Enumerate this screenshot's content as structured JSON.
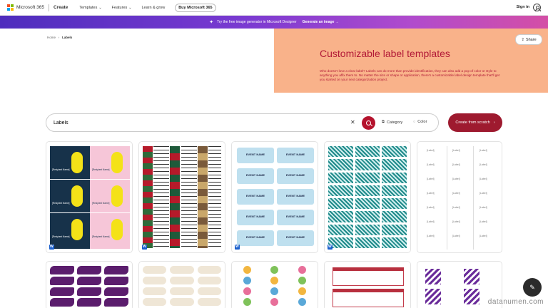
{
  "nav": {
    "brand": "Microsoft 365",
    "create": "Create",
    "templates": "Templates",
    "features": "Features",
    "learn": "Learn & grow",
    "buy": "Buy Microsoft 365",
    "signin": "Sign in"
  },
  "promo": {
    "text": "Try the free image generator in Microsoft Designer",
    "link": "Generate an image"
  },
  "breadcrumb": {
    "home": "Home",
    "current": "Labels"
  },
  "hero": {
    "title": "Customizable label templates",
    "description": "Who doesn't love a clear label? Labels can do more than provide identification, they can also add a pop of color or style to anything you affix them to. No matter the size or shape or application, there's a customizable label design template that'll get you started on your next categorization project.",
    "share": "Share"
  },
  "search": {
    "value": "Labels",
    "category": "Category",
    "color": "Color",
    "create": "Create from scratch"
  },
  "colors": {
    "accent": "#b4122d",
    "hero_bg": "#f9b28a",
    "create_btn": "#9e1a2f"
  },
  "watermark": "datanumen.com",
  "labels": {
    "recipient": "[Recipient Name]",
    "event_name": "EVENT NAME",
    "label": "[Label]"
  }
}
